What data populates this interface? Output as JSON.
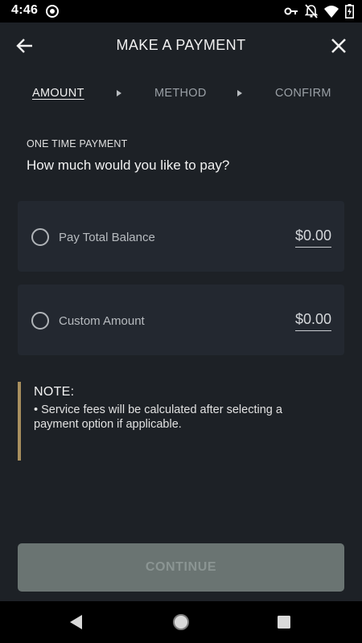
{
  "status_bar": {
    "time": "4:46"
  },
  "header": {
    "title": "MAKE A PAYMENT"
  },
  "steps": [
    {
      "label": "AMOUNT",
      "active": true
    },
    {
      "label": "METHOD",
      "active": false
    },
    {
      "label": "CONFIRM",
      "active": false
    }
  ],
  "section": {
    "label": "ONE TIME PAYMENT",
    "question": "How much would you like to pay?"
  },
  "options": [
    {
      "label": "Pay Total Balance",
      "amount": "$0.00",
      "selected": false
    },
    {
      "label": "Custom Amount",
      "amount": "$0.00",
      "selected": false
    }
  ],
  "note": {
    "title": "NOTE:",
    "body": "• Service fees will be calculated after selecting a payment option if applicable."
  },
  "continue_button": {
    "label": "CONTINUE"
  },
  "colors": {
    "background": "#1d2126",
    "card": "#232830",
    "note_accent": "#a88f5e",
    "button_disabled": "#6a7472"
  }
}
